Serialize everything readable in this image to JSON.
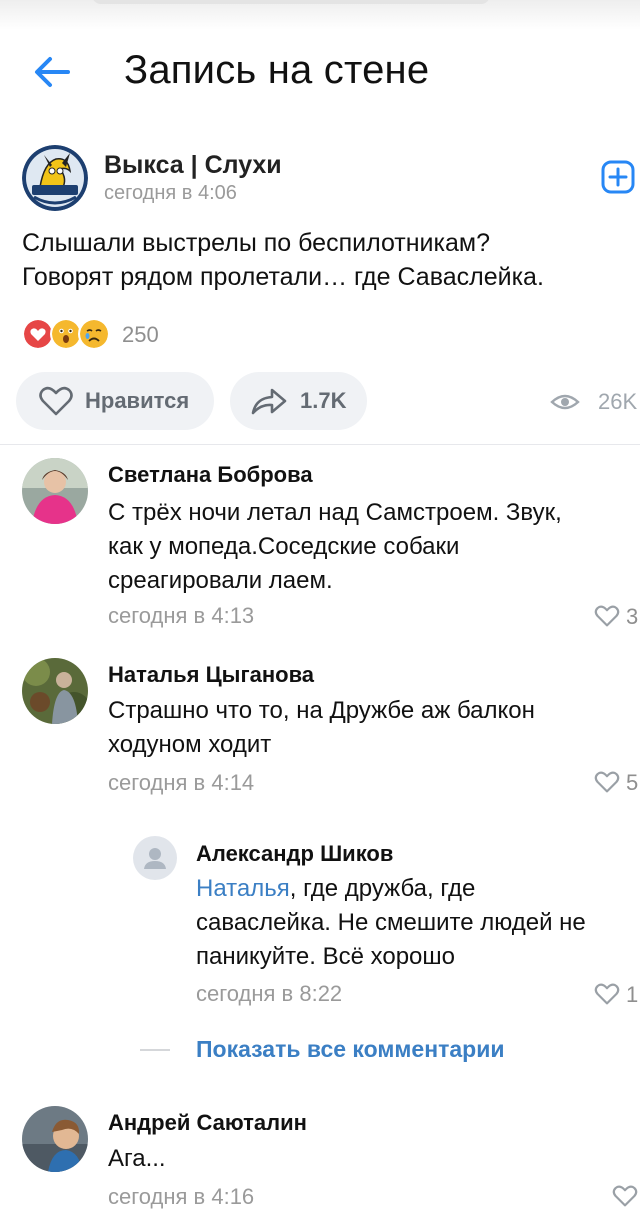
{
  "header": {
    "title": "Запись на стене"
  },
  "post": {
    "group_name": "Выкса | Слухи",
    "time": "сегодня в 4:06",
    "logo_text": "ВЫКСА | СЛУХИ",
    "text_lines": [
      "Слышали выстрелы по беспилотникам?",
      "Говорят рядом пролетали… где Саваслейка."
    ],
    "reactions": [
      "heart",
      "surprised",
      "sad"
    ],
    "reaction_count": "250",
    "like_label": "Нравится",
    "share_count": "1.7K",
    "views_count": "26K"
  },
  "comments": [
    {
      "author": "Светлана Боброва",
      "text_lines": [
        "С трёх ночи летал над Самстроем. Звук,",
        "как у мопеда.Соседские собаки",
        "среагировали лаем."
      ],
      "time": "сегодня в 4:13",
      "likes": "3"
    },
    {
      "author": "Наталья Цыганова",
      "text_lines": [
        "Страшно что то, на Дружбе аж балкон",
        "ходуном ходит"
      ],
      "time": "сегодня в 4:14",
      "likes": "5"
    },
    {
      "author": "Андрей Саюталин",
      "text_lines": [
        "Ага..."
      ],
      "time": "сегодня в 4:16",
      "likes": ""
    }
  ],
  "reply": {
    "author": "Александр Шиков",
    "mention": "Наталья",
    "line1_rest": ", где дружба, где",
    "text_lines": [
      "саваслейка. Не смешите людей не",
      "паникуйте. Всё хорошо"
    ],
    "time": "сегодня в 8:22",
    "likes": "1"
  },
  "show_all_label": "Показать все комментарии",
  "colors": {
    "accent": "#3b7fc4",
    "muted_text": "#9a9a9a",
    "chip_bg": "#f0f2f5",
    "heart_red": "#e64646"
  },
  "icons": [
    "arrow-left-icon",
    "plus-square-icon",
    "heart-outline-icon",
    "share-arrow-icon",
    "eye-icon",
    "person-icon"
  ]
}
